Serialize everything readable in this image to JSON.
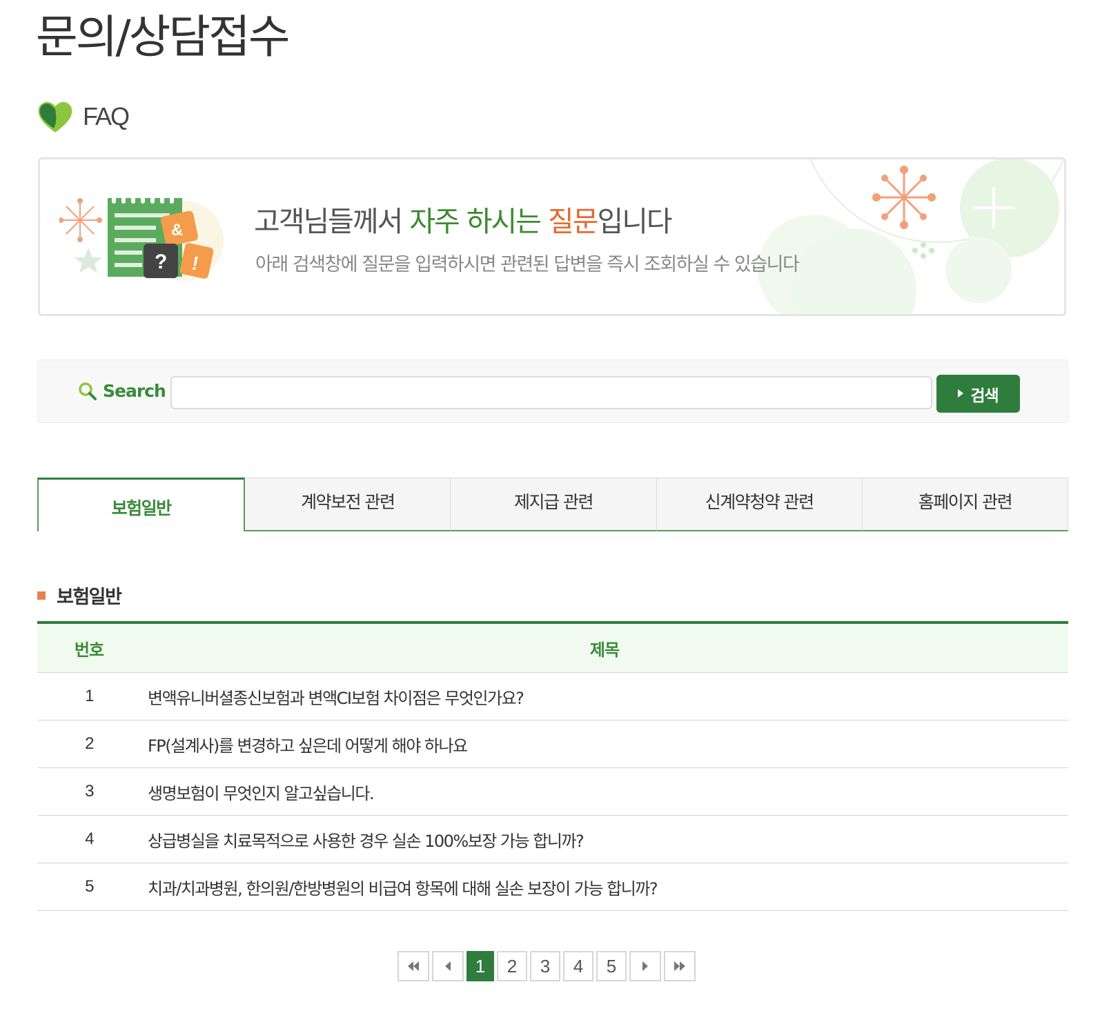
{
  "page": {
    "title": "문의/상담접수"
  },
  "faq_heading": {
    "label": "FAQ"
  },
  "banner": {
    "title_part1": "고객님들께서 ",
    "title_green": "자주 하시는 ",
    "title_orange": "질문",
    "title_part2": "입니다",
    "subtitle": "아래 검색창에 질문을 입력하시면 관련된 답변을 즉시 조회하실 수 있습니다",
    "illustration_text_q": "?",
    "illustration_text_amp": "&",
    "illustration_text_excl": "!"
  },
  "search": {
    "label": "Search",
    "value": "",
    "placeholder": "",
    "button_label": "검색"
  },
  "tabs": [
    {
      "label": "보험일반",
      "active": true
    },
    {
      "label": "계약보전 관련",
      "active": false
    },
    {
      "label": "제지급 관련",
      "active": false
    },
    {
      "label": "신계약청약 관련",
      "active": false
    },
    {
      "label": "홈페이지 관련",
      "active": false
    }
  ],
  "section": {
    "title": "보험일반"
  },
  "table": {
    "headers": {
      "num": "번호",
      "title": "제목"
    },
    "rows": [
      {
        "num": "1",
        "title": "변액유니버셜종신보험과 변액CI보험 차이점은 무엇인가요?"
      },
      {
        "num": "2",
        "title": "FP(설계사)를 변경하고 싶은데 어떻게 해야 하나요"
      },
      {
        "num": "3",
        "title": "생명보험이 무엇인지 알고싶습니다."
      },
      {
        "num": "4",
        "title": "상급병실을 치료목적으로 사용한 경우 실손 100%보장 가능 합니까?"
      },
      {
        "num": "5",
        "title": "치과/치과병원, 한의원/한방병원의 비급여 항목에 대해 실손 보장이 가능 합니까?"
      }
    ]
  },
  "pagination": {
    "pages": [
      "1",
      "2",
      "3",
      "4",
      "5"
    ],
    "current": "1"
  },
  "colors": {
    "brand_green": "#2e7d3c",
    "accent_green": "#3a8a3a",
    "accent_orange": "#e8692c",
    "header_bg": "#f1faee"
  },
  "icons": {
    "faq": "heart-leaf-icon",
    "search": "search-icon",
    "first": "double-chevron-left-icon",
    "prev": "chevron-left-icon",
    "next": "chevron-right-icon",
    "last": "double-chevron-right-icon"
  }
}
